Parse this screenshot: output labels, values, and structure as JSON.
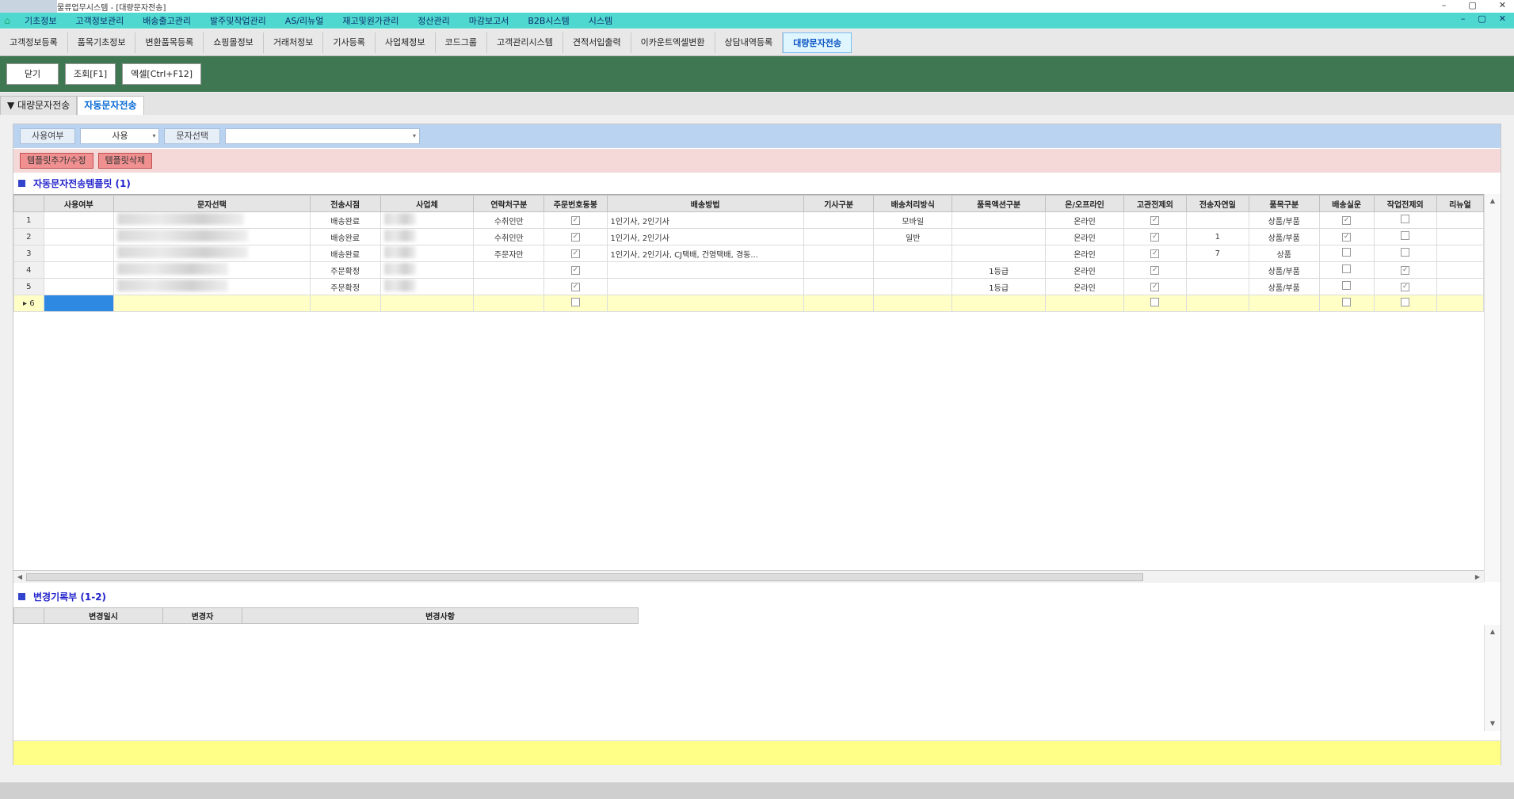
{
  "window": {
    "title": "물류업무시스템 - [대량문자전송]",
    "controls": [
      "–",
      "▢",
      "✕"
    ]
  },
  "menu": {
    "items": [
      "기초정보",
      "고객정보관리",
      "배송출고관리",
      "발주및작업관리",
      "AS/리뉴얼",
      "재고및원가관리",
      "정산관리",
      "마감보고서",
      "B2B시스템",
      "시스템"
    ],
    "mdi_controls": [
      "–",
      "▢",
      "✕"
    ]
  },
  "tabs": [
    "고객정보등록",
    "품목기초정보",
    "변환품목등록",
    "쇼핑몰정보",
    "거래처정보",
    "기사등록",
    "사업체정보",
    "코드그룹",
    "고객관리시스템",
    "견적서입출력",
    "이카운트엑셀변환",
    "상담내역등록",
    "대량문자전송"
  ],
  "active_tab": "대량문자전송",
  "toolbar": {
    "close": "닫기",
    "search": "조회[F1]",
    "excel": "엑셀[Ctrl+F12]"
  },
  "subtabs": {
    "parent": "대량문자전송",
    "active": "자동문자전송"
  },
  "filter": {
    "usage_label": "사용여부",
    "usage_value": "사용",
    "message_label": "문자선택",
    "message_value": ""
  },
  "actions": {
    "add_edit": "템플릿추가/수정",
    "delete": "템플릿삭제"
  },
  "template_section": {
    "title": "자동문자전송템플릿 (1)"
  },
  "template_grid": {
    "columns": [
      "사용여부",
      "문자선택",
      "전송시점",
      "사업체",
      "연락처구분",
      "주문번호동봉",
      "배송방법",
      "기사구분",
      "배송처리방식",
      "품목액션구분",
      "온/오프라인",
      "고관전제외",
      "전송자연일",
      "품목구분",
      "배송실운",
      "작업전제외",
      "리뉴얼"
    ],
    "rows": [
      {
        "no": "1",
        "use": "",
        "msg": "",
        "timing": "배송완료",
        "company": "",
        "contact": "수취인만",
        "order_no": true,
        "delivery": "1인기사, 2인기사",
        "driver": "",
        "method": "모바일",
        "action": "",
        "online": "온라인",
        "excl": true,
        "days": "",
        "item": "상품/부품",
        "ship": true,
        "work": false
      },
      {
        "no": "2",
        "use": "",
        "msg": "",
        "timing": "배송완료",
        "company": "",
        "contact": "수취인만",
        "order_no": true,
        "delivery": "1인기사, 2인기사",
        "driver": "",
        "method": "일반",
        "action": "",
        "online": "온라인",
        "excl": true,
        "days": "1",
        "item": "상품/부품",
        "ship": true,
        "work": false
      },
      {
        "no": "3",
        "use": "",
        "msg": "",
        "timing": "배송완료",
        "company": "",
        "contact": "주문자만",
        "order_no": true,
        "delivery": "1인기사, 2인기사, CJ택배, 건영택배, 경동...",
        "driver": "",
        "method": "",
        "action": "",
        "online": "온라인",
        "excl": true,
        "days": "7",
        "item": "상품",
        "ship": false,
        "work": false
      },
      {
        "no": "4",
        "use": "",
        "msg": "",
        "timing": "주문확정",
        "company": "",
        "contact": "",
        "order_no": true,
        "delivery": "",
        "driver": "",
        "method": "",
        "action": "1등급",
        "online": "온라인",
        "excl": true,
        "days": "",
        "item": "상품/부품",
        "ship": false,
        "work": true
      },
      {
        "no": "5",
        "use": "",
        "msg": "",
        "timing": "주문확정",
        "company": "",
        "contact": "",
        "order_no": true,
        "delivery": "",
        "driver": "",
        "method": "",
        "action": "1등급",
        "online": "온라인",
        "excl": true,
        "days": "",
        "item": "상품/부품",
        "ship": false,
        "work": true
      }
    ],
    "new_row_no": "6"
  },
  "history_section": {
    "title": "변경기록부 (1-2)",
    "columns": [
      "변경일시",
      "변경자",
      "변경사항"
    ]
  }
}
